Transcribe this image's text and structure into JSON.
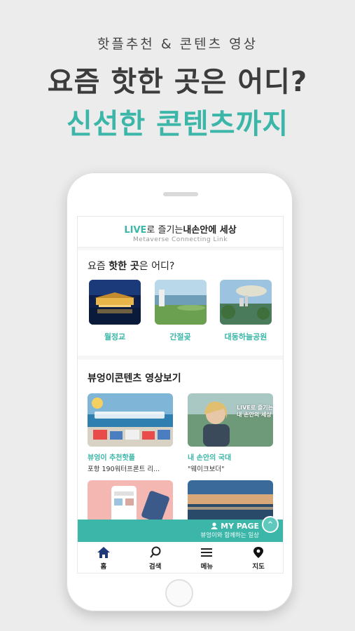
{
  "promo": {
    "subtitle": "핫플추천 & 콘텐츠 영상",
    "title_line1": "요즘 핫한 곳은 어디?",
    "title_line2": "신선한 콘텐츠까지"
  },
  "app_header": {
    "live": "LIVE",
    "middle": "로 즐기는",
    "brand": "내손안에 세상",
    "tagline": "Metaverse Connecting Link"
  },
  "hot_places": {
    "title_prefix": "요즘 ",
    "title_bold": "핫한 곳",
    "title_suffix": "은 어디?",
    "items": [
      {
        "label": "월정교"
      },
      {
        "label": "간절곶"
      },
      {
        "label": "대동하늘공원"
      }
    ]
  },
  "videos": {
    "title": "뷰엉이콘텐츠 영상보기",
    "items": [
      {
        "title": "뷰엉이 추천핫플",
        "desc": "포항 190워터프론트 리..."
      },
      {
        "title": "내 손안의 국대",
        "desc": "\"웨이크보더\"",
        "overlay": "LIVE로 즐기는\n내 손안의 세상"
      },
      {
        "title": "",
        "desc": ""
      },
      {
        "title": "",
        "desc": ""
      }
    ]
  },
  "mypage": {
    "title": "MY PAGE",
    "subtitle": "뷰엉이와 함께하는 일상"
  },
  "tabbar": {
    "items": [
      {
        "label": "홈",
        "icon": "home-icon"
      },
      {
        "label": "검색",
        "icon": "search-icon"
      },
      {
        "label": "메뉴",
        "icon": "menu-icon"
      },
      {
        "label": "지도",
        "icon": "map-pin-icon"
      }
    ]
  },
  "colors": {
    "accent": "#3bb6a8",
    "text": "#3c3c3c",
    "background": "#ececec"
  }
}
